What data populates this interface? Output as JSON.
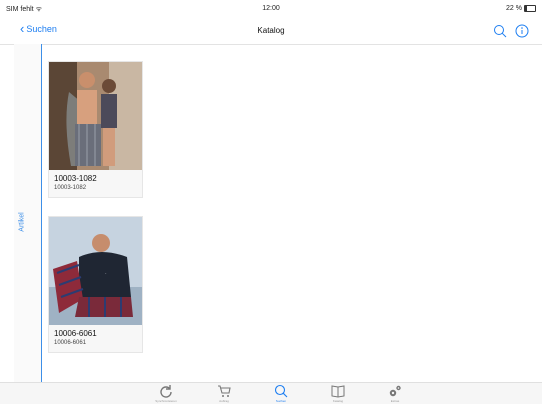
{
  "status": {
    "carrier": "SIM fehlt ᯤ",
    "time": "12:00",
    "battery": "22 %"
  },
  "nav": {
    "back_label": "Suchen",
    "title": "Katalog",
    "icons": [
      "search-icon",
      "info-search-icon"
    ]
  },
  "side_tab": {
    "label": "Artikel"
  },
  "products": [
    {
      "name": "10003-1082",
      "code": "10003-1082"
    },
    {
      "name": "10006-6061",
      "code": "10006-6061"
    }
  ],
  "tab_bar": {
    "items": [
      {
        "icon": "sync-icon",
        "label": "Synchronisieren"
      },
      {
        "icon": "cart-icon",
        "label": "Auftrag"
      },
      {
        "icon": "search-icon",
        "label": "Suchen"
      },
      {
        "icon": "catalog-icon",
        "label": "Katalog"
      },
      {
        "icon": "settings-icon",
        "label": "Extras"
      }
    ],
    "active_index": 2
  },
  "colors": {
    "accent": "#1d7ef1",
    "side_line": "#3d8fe8"
  }
}
